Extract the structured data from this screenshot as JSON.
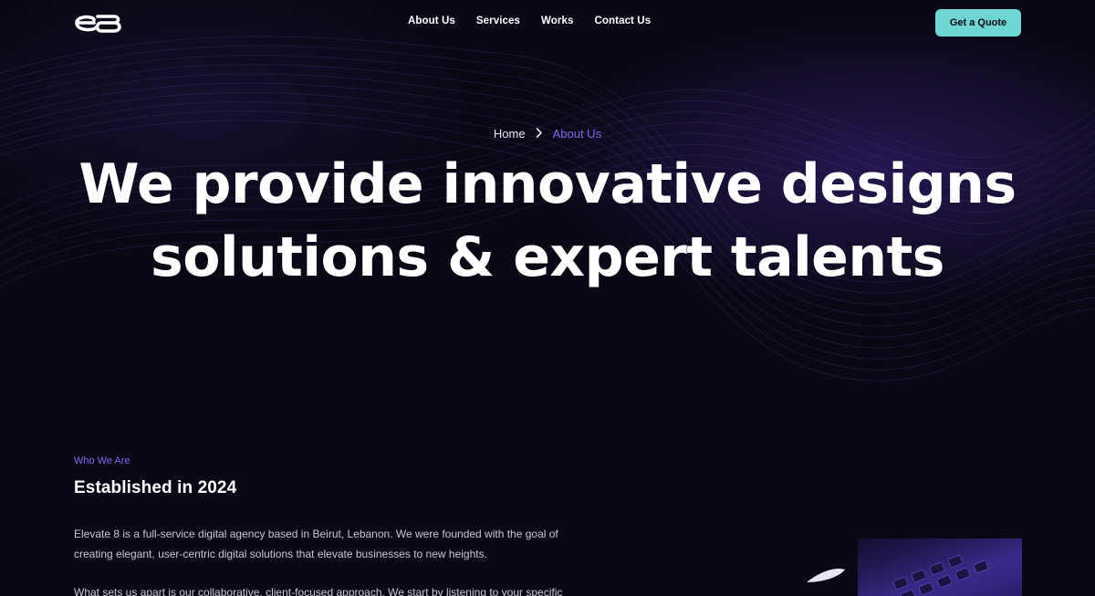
{
  "header": {
    "logo_alt": "e8",
    "nav": [
      {
        "label": "About Us"
      },
      {
        "label": "Services"
      },
      {
        "label": "Works"
      },
      {
        "label": "Contact Us"
      }
    ],
    "cta_label": "Get a Quote"
  },
  "breadcrumb": {
    "home": "Home",
    "separator": "›",
    "current": "About Us"
  },
  "hero": {
    "title_line1": "We provide innovative designs",
    "title_line2": "solutions & expert talents"
  },
  "about": {
    "eyebrow": "Who We Are",
    "title": "Established in 2024",
    "paragraph1_line1": "Elevate 8 is a full-service digital agency based in Beirut, Lebanon. We were founded with the goal of",
    "paragraph1_line2": "creating elegant, user-centric digital solutions that elevate businesses to new heights.",
    "paragraph2_line1": "What sets us apart is our collaborative, client-focused approach. We start by listening to your specific"
  },
  "colors": {
    "background": "#0b0816",
    "accent": "#7b6cf0",
    "cta": "#6fd6d3"
  },
  "icons": {
    "breadcrumb_separator": "chevron-right-icon"
  }
}
